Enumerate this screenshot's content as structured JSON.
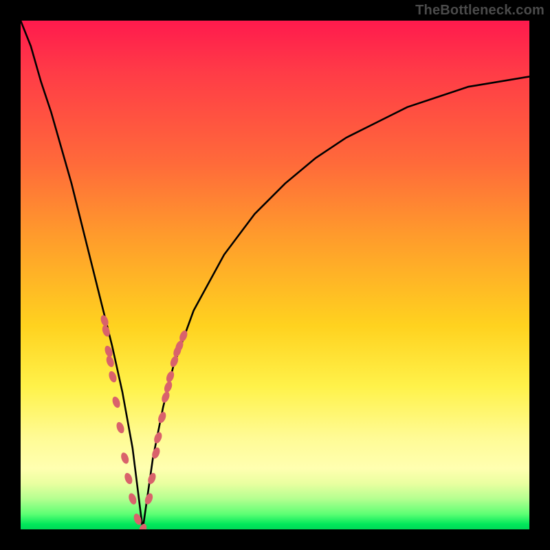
{
  "watermark": "TheBottleneck.com",
  "colors": {
    "curve": "#000000",
    "marker": "#d9626b",
    "frame": "#000000"
  },
  "chart_data": {
    "type": "line",
    "title": "",
    "xlabel": "",
    "ylabel": "",
    "xlim": [
      0,
      100
    ],
    "ylim": [
      0,
      100
    ],
    "optimal_x": 24,
    "series": [
      {
        "name": "bottleneck-curve",
        "x": [
          0,
          2,
          4,
          6,
          8,
          10,
          12,
          14,
          16,
          18,
          20,
          22,
          24,
          26,
          28,
          30,
          34,
          40,
          46,
          52,
          58,
          64,
          70,
          76,
          82,
          88,
          94,
          100
        ],
        "values": [
          100,
          95,
          88,
          82,
          75,
          68,
          60,
          52,
          44,
          36,
          27,
          16,
          0,
          14,
          24,
          32,
          43,
          54,
          62,
          68,
          73,
          77,
          80,
          83,
          85,
          87,
          88,
          89
        ]
      }
    ],
    "markers_left": [
      {
        "x": 16.5,
        "y": 41
      },
      {
        "x": 16.8,
        "y": 39
      },
      {
        "x": 17.3,
        "y": 35
      },
      {
        "x": 17.6,
        "y": 33
      },
      {
        "x": 18.1,
        "y": 30
      },
      {
        "x": 18.8,
        "y": 25
      },
      {
        "x": 19.6,
        "y": 20
      },
      {
        "x": 20.5,
        "y": 14
      },
      {
        "x": 21.2,
        "y": 10
      },
      {
        "x": 22.0,
        "y": 6
      },
      {
        "x": 23.0,
        "y": 2
      },
      {
        "x": 24.0,
        "y": 0
      }
    ],
    "markers_right": [
      {
        "x": 25.2,
        "y": 6
      },
      {
        "x": 25.8,
        "y": 10
      },
      {
        "x": 26.6,
        "y": 15
      },
      {
        "x": 27.0,
        "y": 18
      },
      {
        "x": 27.8,
        "y": 22
      },
      {
        "x": 28.5,
        "y": 26
      },
      {
        "x": 29.0,
        "y": 28
      },
      {
        "x": 29.4,
        "y": 30
      },
      {
        "x": 30.2,
        "y": 33
      },
      {
        "x": 30.8,
        "y": 35
      },
      {
        "x": 31.2,
        "y": 36
      },
      {
        "x": 32.0,
        "y": 38
      }
    ]
  }
}
